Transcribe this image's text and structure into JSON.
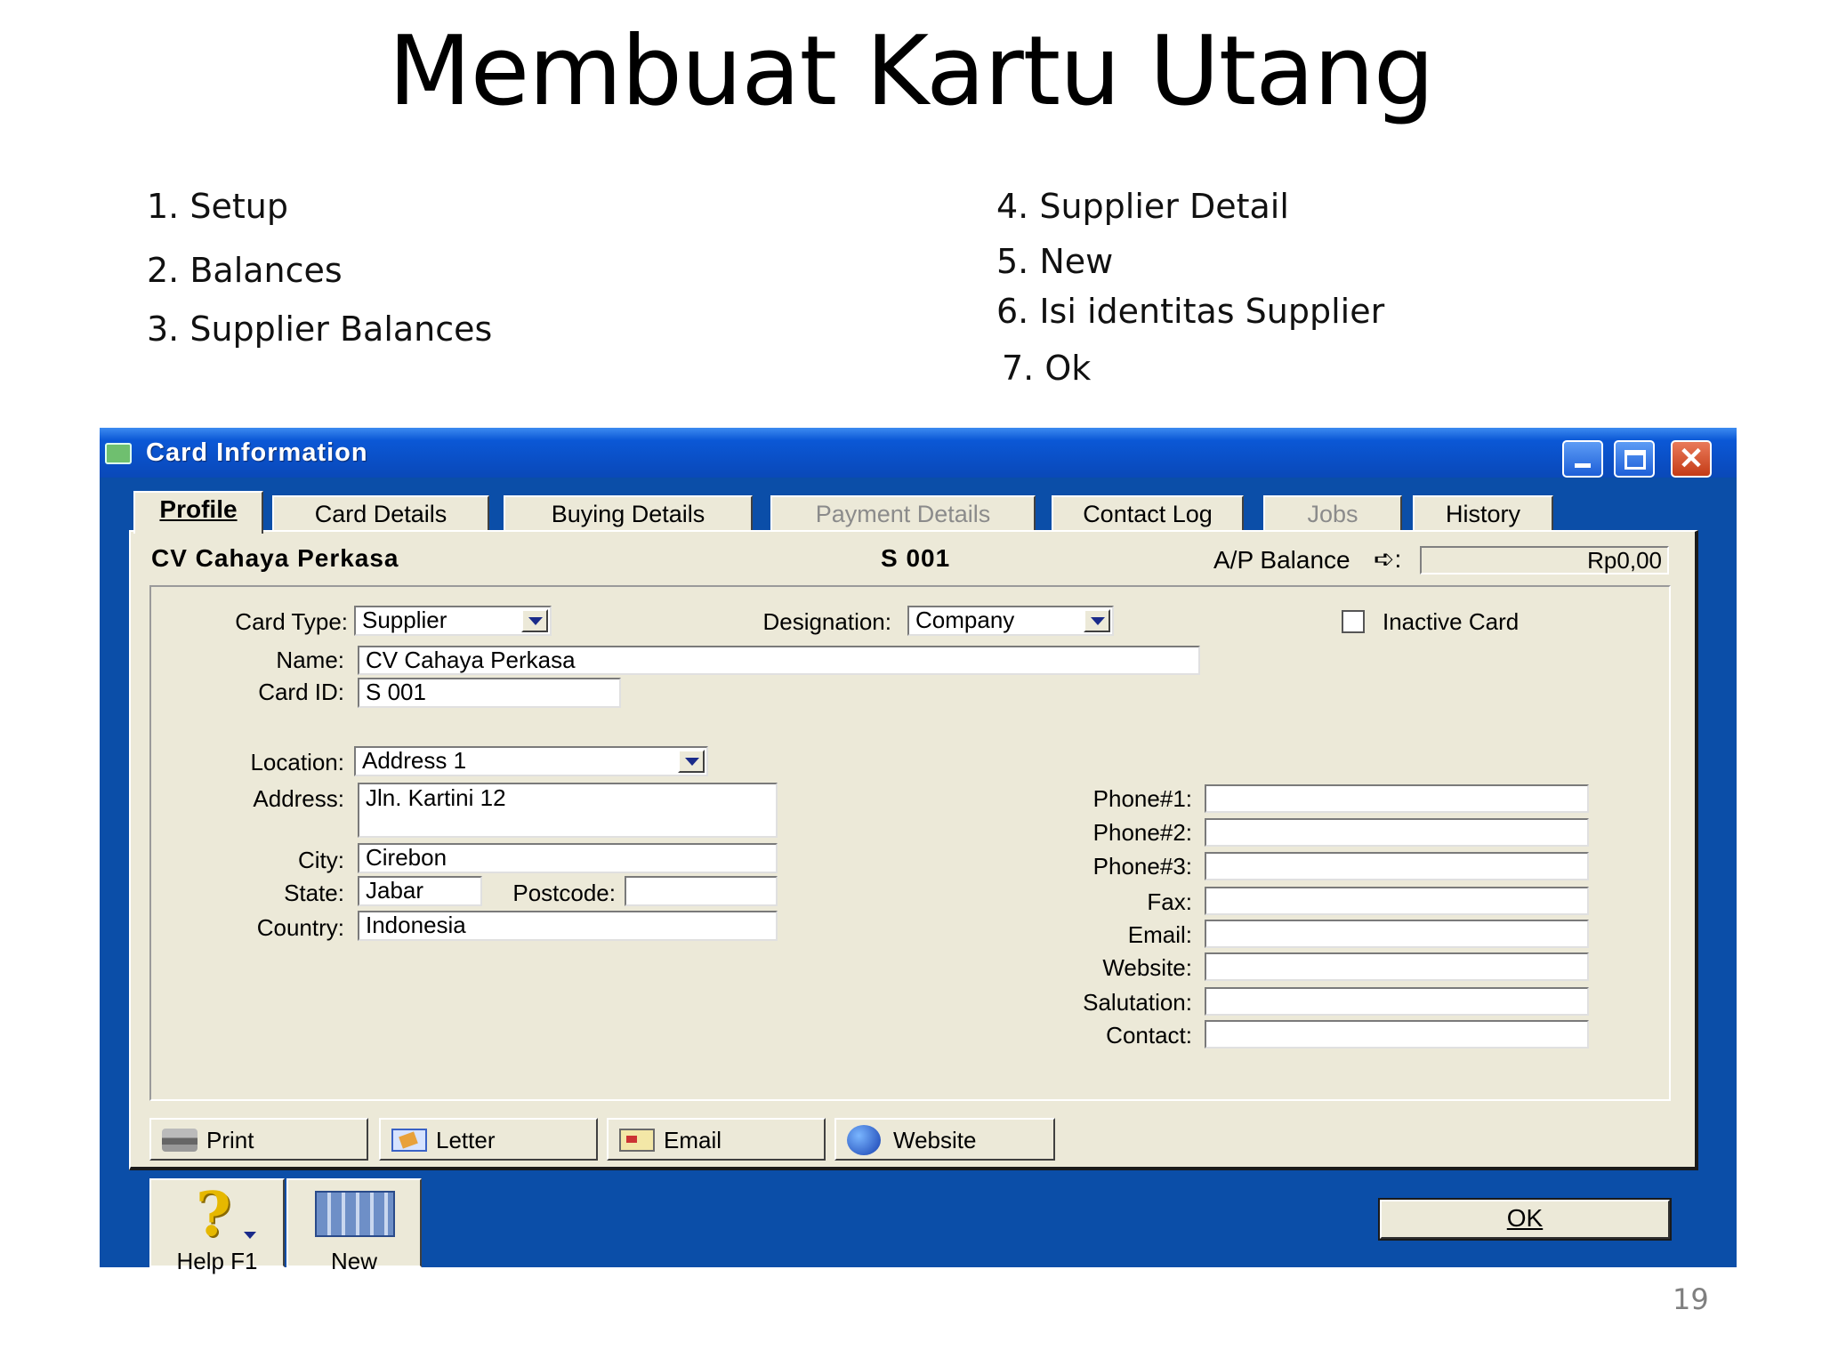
{
  "slide": {
    "title": "Membuat Kartu Utang",
    "page_number": "19",
    "steps_left": [
      "1. Setup",
      "2. Balances",
      "3. Supplier Balances"
    ],
    "steps_right": [
      "4.  Supplier Detail",
      "5. New",
      "6. Isi identitas  Supplier",
      "7. Ok"
    ]
  },
  "window": {
    "title": "Card Information",
    "controls": {
      "minimize": "minimize-icon",
      "maximize": "maximize-icon",
      "close": "close-icon"
    }
  },
  "tabs": [
    {
      "label": "Profile",
      "active": true,
      "enabled": true
    },
    {
      "label": "Card Details",
      "active": false,
      "enabled": true
    },
    {
      "label": "Buying Details",
      "active": false,
      "enabled": true
    },
    {
      "label": "Payment Details",
      "active": false,
      "enabled": false
    },
    {
      "label": "Contact Log",
      "active": false,
      "enabled": true
    },
    {
      "label": "Jobs",
      "active": false,
      "enabled": false
    },
    {
      "label": "History",
      "active": false,
      "enabled": true
    }
  ],
  "header": {
    "card_name": "CV Cahaya Perkasa",
    "card_id": "S 001",
    "ap_balance_label": "A/P Balance",
    "ap_balance_arrow": "➪:",
    "ap_balance_value": "Rp0,00"
  },
  "form": {
    "card_type_label": "Card Type:",
    "card_type_value": "Supplier",
    "designation_label": "Designation:",
    "designation_value": "Company",
    "inactive_label": "Inactive Card",
    "inactive_checked": false,
    "name_label": "Name:",
    "name_value": "CV Cahaya Perkasa",
    "card_id_label": "Card ID:",
    "card_id_value": "S 001",
    "location_label": "Location:",
    "location_value": "Address 1",
    "address_label": "Address:",
    "address_value": "Jln. Kartini 12",
    "city_label": "City:",
    "city_value": "Cirebon",
    "state_label": "State:",
    "state_value": "Jabar",
    "postcode_label": "Postcode:",
    "postcode_value": "",
    "country_label": "Country:",
    "country_value": "Indonesia",
    "contact_fields": [
      {
        "label": "Phone#1:",
        "value": ""
      },
      {
        "label": "Phone#2:",
        "value": ""
      },
      {
        "label": "Phone#3:",
        "value": ""
      },
      {
        "label": "Fax:",
        "value": ""
      },
      {
        "label": "Email:",
        "value": ""
      },
      {
        "label": "Website:",
        "value": ""
      },
      {
        "label": "Salutation:",
        "value": ""
      },
      {
        "label": "Contact:",
        "value": ""
      }
    ]
  },
  "action_buttons": [
    {
      "label": "Print",
      "icon": "printer-icon"
    },
    {
      "label": "Letter",
      "icon": "letter-icon"
    },
    {
      "label": "Email",
      "icon": "envelope-icon"
    },
    {
      "label": "Website",
      "icon": "globe-icon"
    }
  ],
  "footer": {
    "help_label": "Help F1",
    "help_icon": "question-mark-icon",
    "new_label": "New",
    "new_icon": "new-card-icon",
    "ok_label": "OK"
  }
}
